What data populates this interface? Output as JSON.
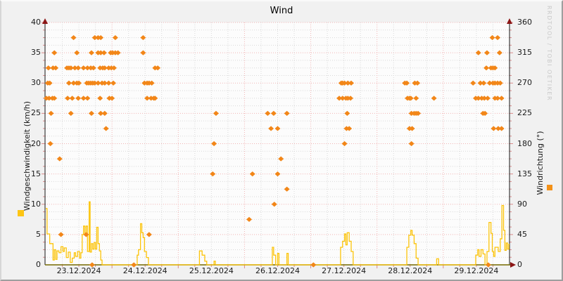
{
  "title": "Wind",
  "watermark": "RRDTOOL / TOBI OETIKER",
  "axes": {
    "left": {
      "label": "Windgeschwindigkeit (km/h)",
      "range": [
        0,
        40
      ],
      "ticks": [
        "0",
        "5",
        "10",
        "15",
        "20",
        "25",
        "30",
        "35",
        "40"
      ]
    },
    "right": {
      "label": "Windrichtung (°)",
      "range": [
        0,
        360
      ],
      "ticks": [
        "0",
        "45",
        "90",
        "135",
        "180",
        "225",
        "270",
        "315",
        "360"
      ]
    },
    "x": {
      "tick_labels": [
        "23.12.2024",
        "24.12.2024",
        "25.12.2024",
        "26.12.2024",
        "27.12.2024",
        "28.12.2024",
        "29.12.2024"
      ],
      "range_days": [
        0,
        7
      ]
    }
  },
  "colors": {
    "direction_marker": "#f28618",
    "speed_line": "#fcc40a",
    "legend_speed": "#fdc513",
    "legend_direction": "#f39118",
    "grid_minor": "#d9d9d9",
    "grid_major": "#f2b4b4",
    "axis_tick": "#d98a8a",
    "axis_vertical": "#4a4a4a",
    "axis_horizontal": "#756a00",
    "arrow": "#8c1616",
    "plot_bg": "#fcfcfc"
  },
  "chart_data": {
    "type": "scatter",
    "x_unit": "days since 23.12.2024 00:00",
    "grid": true,
    "series": [
      {
        "name": "Windrichtung",
        "unit": "°",
        "type": "scatter",
        "marker": "diamond",
        "axis": "right",
        "ylim": [
          0,
          360
        ],
        "points": [
          [
            0.42,
            337.5
          ],
          [
            0.74,
            337.5
          ],
          [
            0.79,
            337.5
          ],
          [
            0.83,
            337.5
          ],
          [
            1.05,
            337.5
          ],
          [
            1.47,
            337.5
          ],
          [
            6.74,
            337.5
          ],
          [
            6.82,
            337.5
          ],
          [
            0.13,
            315
          ],
          [
            0.47,
            315
          ],
          [
            0.69,
            315
          ],
          [
            0.79,
            315
          ],
          [
            0.83,
            315
          ],
          [
            0.88,
            315
          ],
          [
            0.98,
            315
          ],
          [
            1.01,
            315
          ],
          [
            1.05,
            315
          ],
          [
            1.09,
            315
          ],
          [
            1.47,
            315
          ],
          [
            6.53,
            315
          ],
          [
            6.66,
            315
          ],
          [
            6.85,
            315
          ],
          [
            0.04,
            292.5
          ],
          [
            0.11,
            292.5
          ],
          [
            0.15,
            292.5
          ],
          [
            0.32,
            292.5
          ],
          [
            0.35,
            292.5
          ],
          [
            0.38,
            292.5
          ],
          [
            0.44,
            292.5
          ],
          [
            0.49,
            292.5
          ],
          [
            0.57,
            292.5
          ],
          [
            0.63,
            292.5
          ],
          [
            0.68,
            292.5
          ],
          [
            0.72,
            292.5
          ],
          [
            0.82,
            292.5
          ],
          [
            0.86,
            292.5
          ],
          [
            0.89,
            292.5
          ],
          [
            0.95,
            292.5
          ],
          [
            0.99,
            292.5
          ],
          [
            1.03,
            292.5
          ],
          [
            1.65,
            292.5
          ],
          [
            1.69,
            292.5
          ],
          [
            6.65,
            292.5
          ],
          [
            6.72,
            292.5
          ],
          [
            6.75,
            292.5
          ],
          [
            6.78,
            292.5
          ],
          [
            0.03,
            270
          ],
          [
            0.06,
            270
          ],
          [
            0.35,
            270
          ],
          [
            0.42,
            270
          ],
          [
            0.47,
            270
          ],
          [
            0.5,
            270
          ],
          [
            0.62,
            270
          ],
          [
            0.65,
            270
          ],
          [
            0.68,
            270
          ],
          [
            0.71,
            270
          ],
          [
            0.74,
            270
          ],
          [
            0.79,
            270
          ],
          [
            0.85,
            270
          ],
          [
            0.89,
            270
          ],
          [
            0.95,
            270
          ],
          [
            1.02,
            270
          ],
          [
            1.49,
            270
          ],
          [
            1.53,
            270
          ],
          [
            1.56,
            270
          ],
          [
            1.6,
            270
          ],
          [
            4.46,
            270
          ],
          [
            4.48,
            270
          ],
          [
            4.51,
            270
          ],
          [
            4.56,
            270
          ],
          [
            4.61,
            270
          ],
          [
            5.42,
            270
          ],
          [
            5.45,
            270
          ],
          [
            5.57,
            270
          ],
          [
            5.61,
            270
          ],
          [
            6.45,
            270
          ],
          [
            6.56,
            270
          ],
          [
            6.61,
            270
          ],
          [
            6.7,
            270
          ],
          [
            6.75,
            270
          ],
          [
            6.78,
            270
          ],
          [
            6.82,
            270
          ],
          [
            6.86,
            270
          ],
          [
            0.01,
            247.5
          ],
          [
            0.05,
            247.5
          ],
          [
            0.1,
            247.5
          ],
          [
            0.13,
            247.5
          ],
          [
            0.33,
            247.5
          ],
          [
            0.4,
            247.5
          ],
          [
            0.49,
            247.5
          ],
          [
            0.57,
            247.5
          ],
          [
            0.63,
            247.5
          ],
          [
            0.82,
            247.5
          ],
          [
            0.96,
            247.5
          ],
          [
            1.0,
            247.5
          ],
          [
            1.53,
            247.5
          ],
          [
            1.59,
            247.5
          ],
          [
            1.63,
            247.5
          ],
          [
            1.65,
            247.5
          ],
          [
            4.43,
            247.5
          ],
          [
            4.48,
            247.5
          ],
          [
            4.53,
            247.5
          ],
          [
            4.56,
            247.5
          ],
          [
            4.6,
            247.5
          ],
          [
            5.46,
            247.5
          ],
          [
            5.49,
            247.5
          ],
          [
            5.51,
            247.5
          ],
          [
            5.59,
            247.5
          ],
          [
            5.86,
            247.5
          ],
          [
            6.49,
            247.5
          ],
          [
            6.53,
            247.5
          ],
          [
            6.58,
            247.5
          ],
          [
            6.62,
            247.5
          ],
          [
            6.67,
            247.5
          ],
          [
            6.78,
            247.5
          ],
          [
            6.82,
            247.5
          ],
          [
            6.88,
            247.5
          ],
          [
            0.08,
            225
          ],
          [
            0.38,
            225
          ],
          [
            0.69,
            225
          ],
          [
            0.83,
            225
          ],
          [
            0.89,
            225
          ],
          [
            2.57,
            225
          ],
          [
            3.35,
            225
          ],
          [
            3.44,
            225
          ],
          [
            3.64,
            225
          ],
          [
            4.55,
            225
          ],
          [
            5.52,
            225
          ],
          [
            5.56,
            225
          ],
          [
            5.59,
            225
          ],
          [
            5.62,
            225
          ],
          [
            6.6,
            225
          ],
          [
            6.63,
            225
          ],
          [
            0.91,
            202.5
          ],
          [
            3.4,
            202.5
          ],
          [
            3.5,
            202.5
          ],
          [
            4.54,
            202.5
          ],
          [
            4.58,
            202.5
          ],
          [
            5.49,
            202.5
          ],
          [
            5.53,
            202.5
          ],
          [
            6.76,
            202.5
          ],
          [
            6.83,
            202.5
          ],
          [
            6.88,
            202.5
          ],
          [
            0.07,
            180
          ],
          [
            2.54,
            180
          ],
          [
            4.51,
            180
          ],
          [
            5.52,
            180
          ],
          [
            0.21,
            157.5
          ],
          [
            3.55,
            157.5
          ],
          [
            2.52,
            135
          ],
          [
            3.12,
            135
          ],
          [
            3.5,
            135
          ],
          [
            3.64,
            112.5
          ],
          [
            3.45,
            90
          ],
          [
            3.07,
            67.5
          ],
          [
            0.23,
            45
          ],
          [
            0.61,
            45
          ],
          [
            1.56,
            45
          ],
          [
            0.7,
            0
          ],
          [
            1.33,
            0
          ],
          [
            4.04,
            0
          ],
          [
            6.68,
            0
          ]
        ]
      },
      {
        "name": "Windgeschwindigkeit",
        "unit": "km/h",
        "type": "line",
        "step": true,
        "axis": "left",
        "ylim": [
          0,
          40
        ],
        "points": [
          [
            0.0,
            9.3
          ],
          [
            0.02,
            5.1
          ],
          [
            0.06,
            3.5
          ],
          [
            0.11,
            0.8
          ],
          [
            0.13,
            2.5
          ],
          [
            0.15,
            0.9
          ],
          [
            0.17,
            2.3
          ],
          [
            0.2,
            2.0
          ],
          [
            0.23,
            3.0
          ],
          [
            0.26,
            2.2
          ],
          [
            0.28,
            2.8
          ],
          [
            0.31,
            1.2
          ],
          [
            0.34,
            2.1
          ],
          [
            0.37,
            0.4
          ],
          [
            0.4,
            1.1
          ],
          [
            0.43,
            2.0
          ],
          [
            0.45,
            1.4
          ],
          [
            0.48,
            2.2
          ],
          [
            0.51,
            1.1
          ],
          [
            0.53,
            2.0
          ],
          [
            0.55,
            5.0
          ],
          [
            0.57,
            6.4
          ],
          [
            0.59,
            5.0
          ],
          [
            0.61,
            6.4
          ],
          [
            0.63,
            2.2
          ],
          [
            0.655,
            10.4
          ],
          [
            0.67,
            2.1
          ],
          [
            0.69,
            3.5
          ],
          [
            0.71,
            2.6
          ],
          [
            0.73,
            3.7
          ],
          [
            0.75,
            2.6
          ],
          [
            0.77,
            6.2
          ],
          [
            0.79,
            3.5
          ],
          [
            0.81,
            2.3
          ],
          [
            0.83,
            0.8
          ],
          [
            0.85,
            0
          ],
          [
            1.38,
            1.6
          ],
          [
            1.4,
            2.5
          ],
          [
            1.43,
            6.8
          ],
          [
            1.45,
            5.3
          ],
          [
            1.47,
            4.5
          ],
          [
            1.49,
            2.2
          ],
          [
            1.52,
            1.2
          ],
          [
            1.55,
            0
          ],
          [
            2.32,
            2.3
          ],
          [
            2.36,
            1.6
          ],
          [
            2.4,
            0.6
          ],
          [
            2.43,
            0
          ],
          [
            2.54,
            0.6
          ],
          [
            2.56,
            0
          ],
          [
            3.42,
            2.9
          ],
          [
            3.44,
            1.6
          ],
          [
            3.47,
            0
          ],
          [
            3.5,
            1.9
          ],
          [
            3.52,
            0
          ],
          [
            3.64,
            1.9
          ],
          [
            3.66,
            0
          ],
          [
            4.45,
            2.9
          ],
          [
            4.48,
            3.9
          ],
          [
            4.51,
            5.1
          ],
          [
            4.53,
            3.3
          ],
          [
            4.55,
            5.3
          ],
          [
            4.58,
            3.9
          ],
          [
            4.61,
            2.2
          ],
          [
            4.64,
            0
          ],
          [
            5.45,
            2.9
          ],
          [
            5.48,
            4.9
          ],
          [
            5.51,
            5.7
          ],
          [
            5.53,
            4.9
          ],
          [
            5.56,
            3.5
          ],
          [
            5.59,
            1.1
          ],
          [
            5.62,
            0
          ],
          [
            5.9,
            1.0
          ],
          [
            5.93,
            0
          ],
          [
            6.49,
            1.6
          ],
          [
            6.52,
            2.5
          ],
          [
            6.54,
            1.4
          ],
          [
            6.57,
            2.5
          ],
          [
            6.6,
            1.8
          ],
          [
            6.63,
            0
          ],
          [
            6.66,
            2.2
          ],
          [
            6.69,
            7.0
          ],
          [
            6.72,
            5.2
          ],
          [
            6.74,
            2.2
          ],
          [
            6.76,
            1.4
          ],
          [
            6.78,
            2.9
          ],
          [
            6.83,
            2.2
          ],
          [
            6.86,
            4.3
          ],
          [
            6.885,
            9.8
          ],
          [
            6.91,
            5.7
          ],
          [
            6.93,
            2.4
          ],
          [
            6.95,
            3.6
          ],
          [
            6.97,
            2.6
          ],
          [
            6.99,
            3.4
          ]
        ]
      }
    ]
  }
}
